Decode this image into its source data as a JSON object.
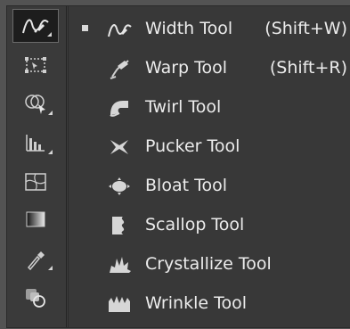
{
  "toolbar": {
    "tools": [
      {
        "icon": "width-tool-icon",
        "active": true
      },
      {
        "icon": "free-transform-icon"
      },
      {
        "icon": "shape-builder-icon"
      },
      {
        "icon": "graph-tool-icon"
      },
      {
        "icon": "mesh-tool-icon"
      },
      {
        "icon": "gradient-tool-icon"
      },
      {
        "icon": "eyedropper-icon"
      },
      {
        "icon": "blend-tool-icon"
      }
    ]
  },
  "flyout": {
    "items": [
      {
        "label": "Width Tool",
        "shortcut": "(Shift+W)",
        "icon": "width-tool-icon",
        "selected": true
      },
      {
        "label": "Warp Tool",
        "shortcut": "(Shift+R)",
        "icon": "warp-tool-icon"
      },
      {
        "label": "Twirl Tool",
        "shortcut": "",
        "icon": "twirl-tool-icon"
      },
      {
        "label": "Pucker Tool",
        "shortcut": "",
        "icon": "pucker-tool-icon"
      },
      {
        "label": "Bloat Tool",
        "shortcut": "",
        "icon": "bloat-tool-icon"
      },
      {
        "label": "Scallop Tool",
        "shortcut": "",
        "icon": "scallop-tool-icon"
      },
      {
        "label": "Crystallize Tool",
        "shortcut": "",
        "icon": "crystallize-tool-icon"
      },
      {
        "label": "Wrinkle Tool",
        "shortcut": "",
        "icon": "wrinkle-tool-icon"
      }
    ]
  }
}
